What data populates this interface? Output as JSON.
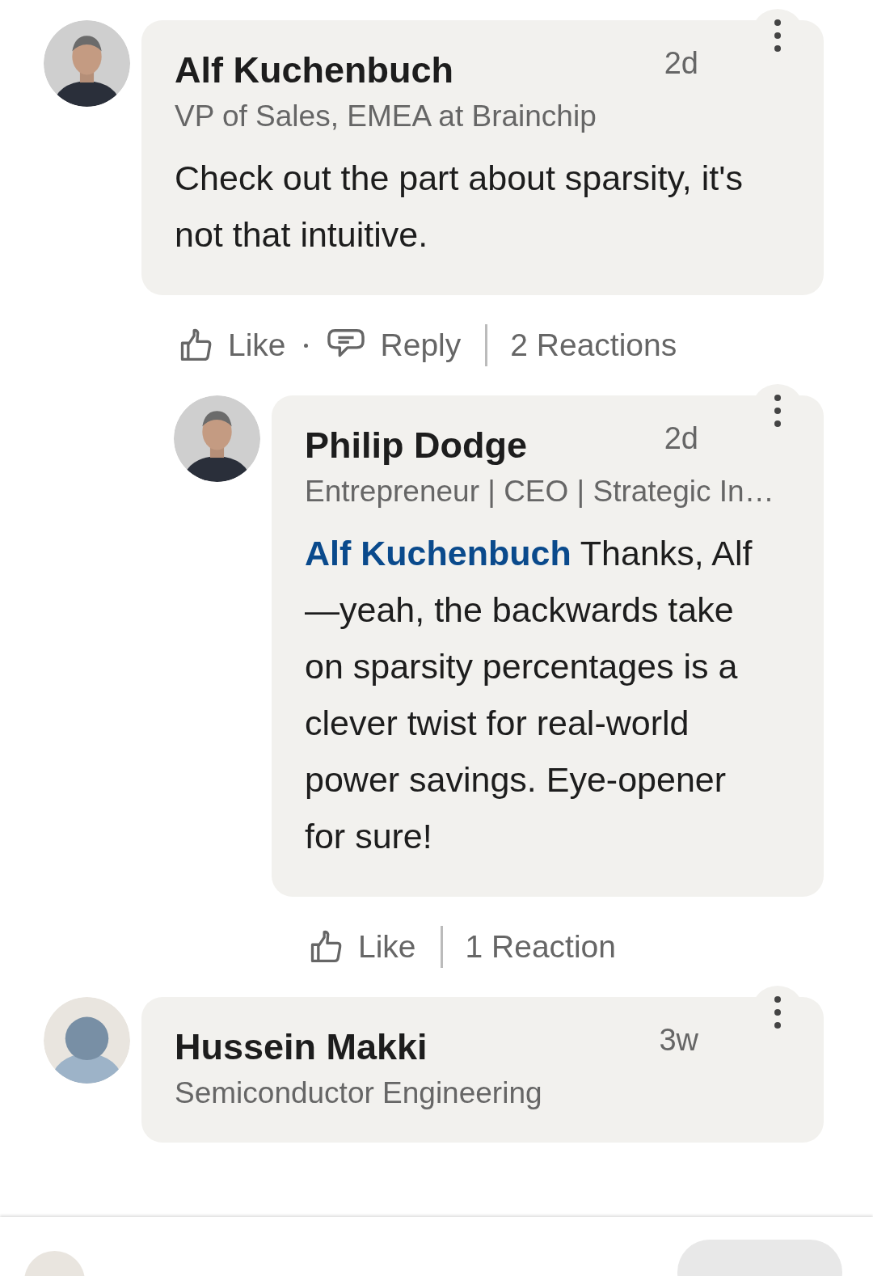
{
  "comments": [
    {
      "author": "Alf Kuchenbuch",
      "avatar": {
        "kind": "photo"
      },
      "time": "2d",
      "headline": "VP of Sales, EMEA at Brainchip",
      "body": "Check out the part about sparsity, it's not that intuitive.",
      "actions": [
        {
          "kind": "like",
          "label": "Like"
        },
        {
          "kind": "reply",
          "label": "Reply"
        },
        {
          "kind": "reactions",
          "label": "2 Reactions"
        }
      ],
      "children": [
        {
          "author": "Philip Dodge",
          "avatar": {
            "kind": "photo"
          },
          "time": "2d",
          "headline": "Entrepreneur | CEO | Strategic In…",
          "mention": "Alf Kuchenbuch",
          "body": "Thanks, Alf—yeah, the backwards take on sparsity percentages is a clever twist for real-world power savings. Eye-opener for sure!",
          "actions": [
            {
              "kind": "like",
              "label": "Like"
            },
            {
              "kind": "reactions",
              "label": "1 Reaction"
            }
          ]
        }
      ]
    },
    {
      "author": "Hussein Makki",
      "avatar": {
        "kind": "placeholder"
      },
      "time": "3w",
      "headline": "Semiconductor Engineering"
    }
  ]
}
